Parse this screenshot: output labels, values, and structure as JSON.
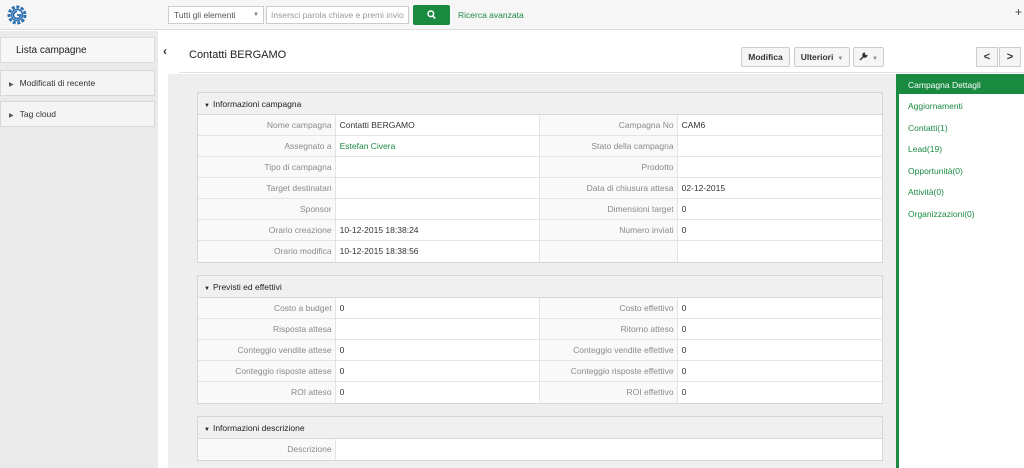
{
  "colors": {
    "accent": "#1a8a41"
  },
  "topbar": {
    "logo_icon": "gear-logo-icon",
    "scope_value": "Tutti gli elementi",
    "search_placeholder": "Insersci parola chiave e premi invio",
    "advanced_search": "Ricerca avanzata",
    "plus_label": "+"
  },
  "sidebar": {
    "title": "Lista campagne",
    "items": [
      {
        "label": "Modificati di recente"
      },
      {
        "label": "Tag cloud"
      }
    ]
  },
  "header": {
    "title": "Contatti BERGAMO",
    "edit_label": "Modifica",
    "more_label": "Ulteriori",
    "prev_label": "<",
    "next_label": ">"
  },
  "blocks": {
    "info": {
      "title": "Informazioni campagna",
      "rows": [
        {
          "l1": "Nome campagna",
          "v1": "Contatti BERGAMO",
          "l2": "Campagna No",
          "v2": "CAM6"
        },
        {
          "l1": "Assegnato a",
          "v1": "Estefan Civera",
          "l2": "Stato della campagna",
          "v2": ""
        },
        {
          "l1": "Tipo di campagna",
          "v1": "",
          "l2": "Prodotto",
          "v2": ""
        },
        {
          "l1": "Target destinatari",
          "v1": "",
          "l2": "Data di chiusura attesa",
          "v2": "02-12-2015"
        },
        {
          "l1": "Sponsor",
          "v1": "",
          "l2": "Dimensioni target",
          "v2": "0"
        },
        {
          "l1": "Orario creazione",
          "v1": "10-12-2015 18:38:24",
          "l2": "Numero inviati",
          "v2": "0"
        },
        {
          "l1": "Orario modifica",
          "v1": "10-12-2015 18:38:56",
          "l2": "",
          "v2": ""
        }
      ]
    },
    "expected": {
      "title": "Previsti ed effettivi",
      "rows": [
        {
          "l1": "Costo a budget",
          "v1": "0",
          "l2": "Costo effettivo",
          "v2": "0"
        },
        {
          "l1": "Risposta attesa",
          "v1": "",
          "l2": "Ritorno atteso",
          "v2": "0"
        },
        {
          "l1": "Conteggio vendite attese",
          "v1": "0",
          "l2": "Conteggio vendite effettive",
          "v2": "0"
        },
        {
          "l1": "Conteggio risposte attese",
          "v1": "0",
          "l2": "Conteggio risposte effettive",
          "v2": "0"
        },
        {
          "l1": "ROI atteso",
          "v1": "0",
          "l2": "ROI effettivo",
          "v2": "0"
        }
      ]
    },
    "description": {
      "title": "Informazioni descrizione",
      "label": "Descrizione",
      "value": ""
    }
  },
  "related": {
    "active": "Campagna Dettagli",
    "items": [
      "Aggiornamenti",
      "Contatti(1)",
      "Lead(19)",
      "Opportunità(0)",
      "Attività(0)",
      "Organizzazioni(0)"
    ]
  }
}
